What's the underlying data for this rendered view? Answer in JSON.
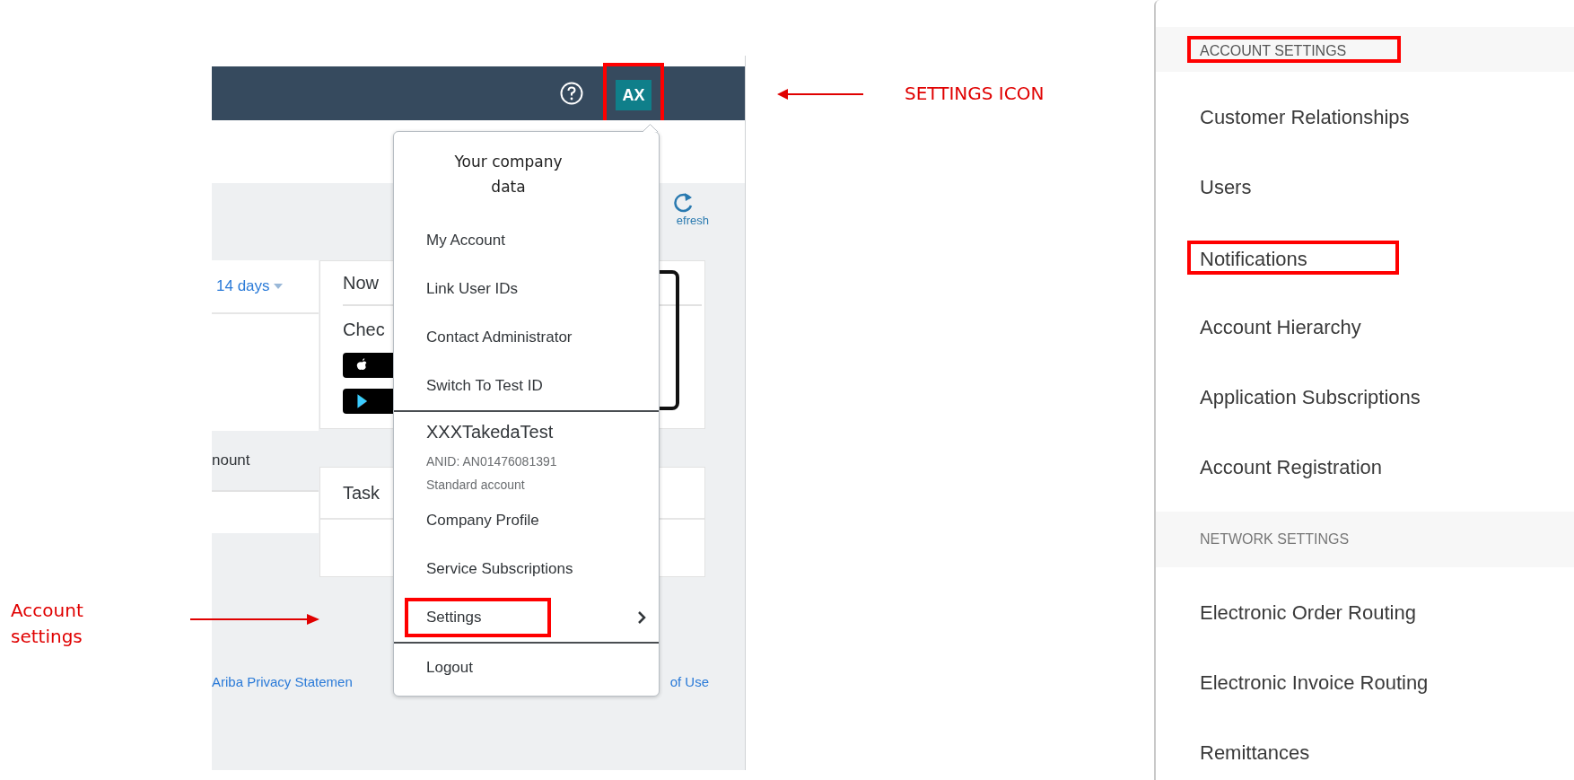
{
  "header": {
    "avatar": {
      "initials": "AX",
      "highlighted": true
    }
  },
  "dashboard": {
    "refresh_label": "efresh",
    "period": "14 days",
    "column_text": "nount",
    "card_title": "Now",
    "card_text": "Chec",
    "tasks_title": "Task",
    "footer_links": [
      "Ariba Privacy Statemen",
      "of Use"
    ]
  },
  "menu": {
    "note": "Your company data",
    "groups": [
      [
        {
          "kind": "link",
          "label": "My Account",
          "highlighted": false
        },
        {
          "kind": "link",
          "label": "Link User IDs",
          "highlighted": false
        },
        {
          "kind": "link",
          "label": "Contact Administrator",
          "highlighted": false
        },
        {
          "kind": "link",
          "label": "Switch To Test ID",
          "highlighted": false
        }
      ],
      [
        {
          "kind": "name",
          "label": "XXXTakedaTest",
          "highlighted": false
        },
        {
          "kind": "meta",
          "label": "ANID: AN01476081391",
          "highlighted": false
        },
        {
          "kind": "meta",
          "label": "Standard account",
          "highlighted": false
        },
        {
          "kind": "link",
          "label": "Company Profile",
          "highlighted": false
        },
        {
          "kind": "link",
          "label": "Service Subscriptions",
          "highlighted": false
        },
        {
          "kind": "submenu",
          "label": "Settings",
          "highlighted": true
        }
      ],
      [
        {
          "kind": "link",
          "label": "Logout",
          "highlighted": false
        }
      ]
    ]
  },
  "settings_panel": {
    "sections": [
      {
        "title": "ACCOUNT SETTINGS",
        "highlighted": true,
        "items": [
          {
            "label": "Customer Relationships",
            "highlighted": false
          },
          {
            "label": "Users",
            "highlighted": false
          },
          {
            "label": "Notifications",
            "highlighted": true
          },
          {
            "label": "Account Hierarchy",
            "highlighted": false
          },
          {
            "label": "Application Subscriptions",
            "highlighted": false
          },
          {
            "label": "Account Registration",
            "highlighted": false
          }
        ]
      },
      {
        "title": "NETWORK SETTINGS",
        "highlighted": false,
        "items": [
          {
            "label": "Electronic Order Routing",
            "highlighted": false
          },
          {
            "label": "Electronic Invoice Routing",
            "highlighted": false
          },
          {
            "label": "Remittances",
            "highlighted": false
          }
        ]
      }
    ]
  },
  "annotations": [
    {
      "kind": "settings_icon",
      "text": "SETTINGS ICON"
    },
    {
      "kind": "account_settings",
      "text": "Account settings"
    }
  ]
}
